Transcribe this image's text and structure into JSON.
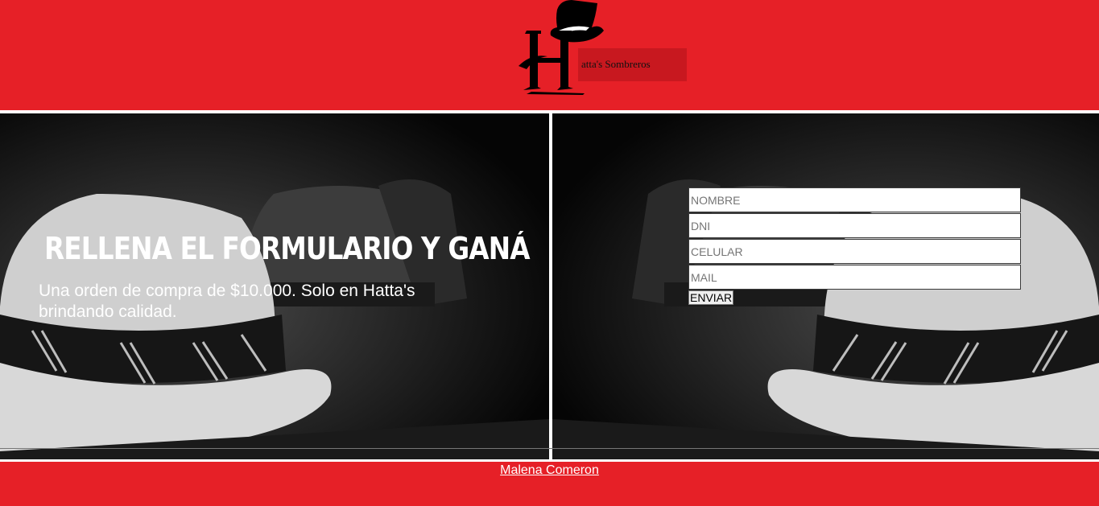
{
  "header": {
    "logo_letter": "H",
    "logo_text": "atta's Sombreros",
    "colors": {
      "brand_red": "#e62027",
      "tag_red": "#c8181f"
    }
  },
  "hero": {
    "headline": "RELLENA EL FORMULARIO Y GANÁ",
    "subtext": "Una orden de compra de $10.000. Solo en Hatta's brindando calidad."
  },
  "form": {
    "nombre_placeholder": "NOMBRE",
    "dni_placeholder": "DNI",
    "celular_placeholder": "CELULAR",
    "mail_placeholder": "MAIL",
    "submit_label": "ENVIAR"
  },
  "footer": {
    "author_link": "Malena Comeron"
  }
}
